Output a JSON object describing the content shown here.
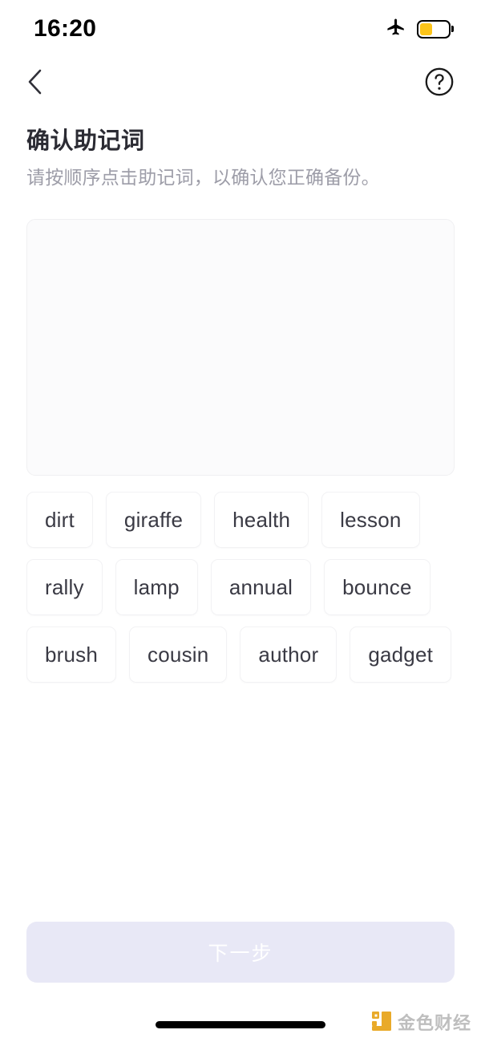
{
  "status_bar": {
    "time": "16:20",
    "airplane_icon": "airplane-mode-icon",
    "battery_icon": "battery-icon",
    "battery_level_percent": 45,
    "battery_color": "#FCC419"
  },
  "nav_bar": {
    "back_icon": "chevron-left-icon",
    "help_icon": "help-circle-icon"
  },
  "header": {
    "title": "确认助记词",
    "subtitle": "请按顺序点击助记词，以确认您正确备份。"
  },
  "answer_box": {
    "selected_words": [],
    "background_color": "#fbfbfc",
    "border_color": "#f0f0f2"
  },
  "word_pool": {
    "words": [
      "dirt",
      "giraffe",
      "health",
      "lesson",
      "rally",
      "lamp",
      "annual",
      "bounce",
      "brush",
      "cousin",
      "author",
      "gadget"
    ]
  },
  "footer": {
    "next_button_label": "下一步",
    "next_button_enabled": false,
    "next_button_bg": "#e8e8f6",
    "next_button_text_color": "#ffffff"
  },
  "home_indicator": {
    "name": "home-indicator-bar"
  },
  "watermark": {
    "brand_text": "金色财经",
    "logo_color": "#E8A317"
  }
}
